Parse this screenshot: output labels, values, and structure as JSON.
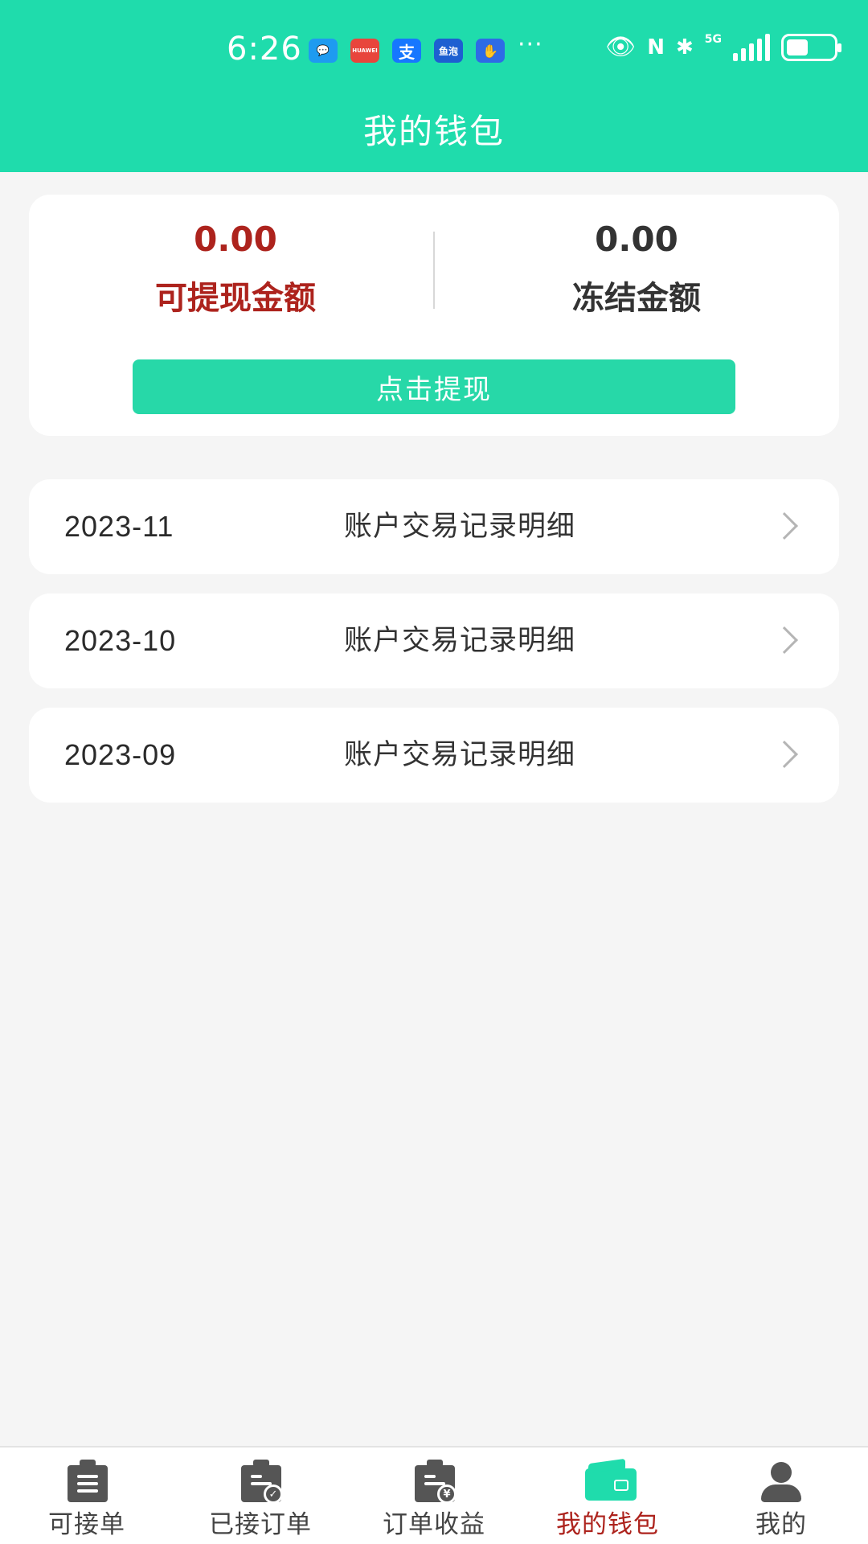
{
  "status_bar": {
    "time": "6:26",
    "notification_icons": [
      {
        "name": "messages-app-icon",
        "glyph": "💬",
        "color": "#1e9bf0"
      },
      {
        "name": "huawei-appgallery-icon",
        "glyph": "HUAWEI",
        "color": "#e8453c"
      },
      {
        "name": "alipay-icon",
        "glyph": "支",
        "color": "#1677ff"
      },
      {
        "name": "yupao-icon",
        "glyph": "鱼泡",
        "color": "#1d5fd1"
      },
      {
        "name": "assistant-icon",
        "glyph": "✋",
        "color": "#2e6be6"
      }
    ],
    "more": "···",
    "network": "5G"
  },
  "header": {
    "title": "我的钱包"
  },
  "balance": {
    "withdrawable_amount": "0.00",
    "withdrawable_label": "可提现金额",
    "frozen_amount": "0.00",
    "frozen_label": "冻结金额",
    "withdraw_button": "点击提现"
  },
  "records": [
    {
      "month": "2023-11",
      "title": "账户交易记录明细"
    },
    {
      "month": "2023-10",
      "title": "账户交易记录明细"
    },
    {
      "month": "2023-09",
      "title": "账户交易记录明细"
    }
  ],
  "tabbar": {
    "tabs": [
      {
        "label": "可接单",
        "icon": "clipboard-list-icon"
      },
      {
        "label": "已接订单",
        "icon": "clipboard-check-icon"
      },
      {
        "label": "订单收益",
        "icon": "clipboard-yen-icon"
      },
      {
        "label": "我的钱包",
        "icon": "wallet-icon",
        "active": true
      },
      {
        "label": "我的",
        "icon": "user-icon"
      }
    ]
  },
  "colors": {
    "brand": "#1fdcac",
    "button": "#27d8a8",
    "accent_red": "#ad231d",
    "background": "#f5f5f5"
  }
}
